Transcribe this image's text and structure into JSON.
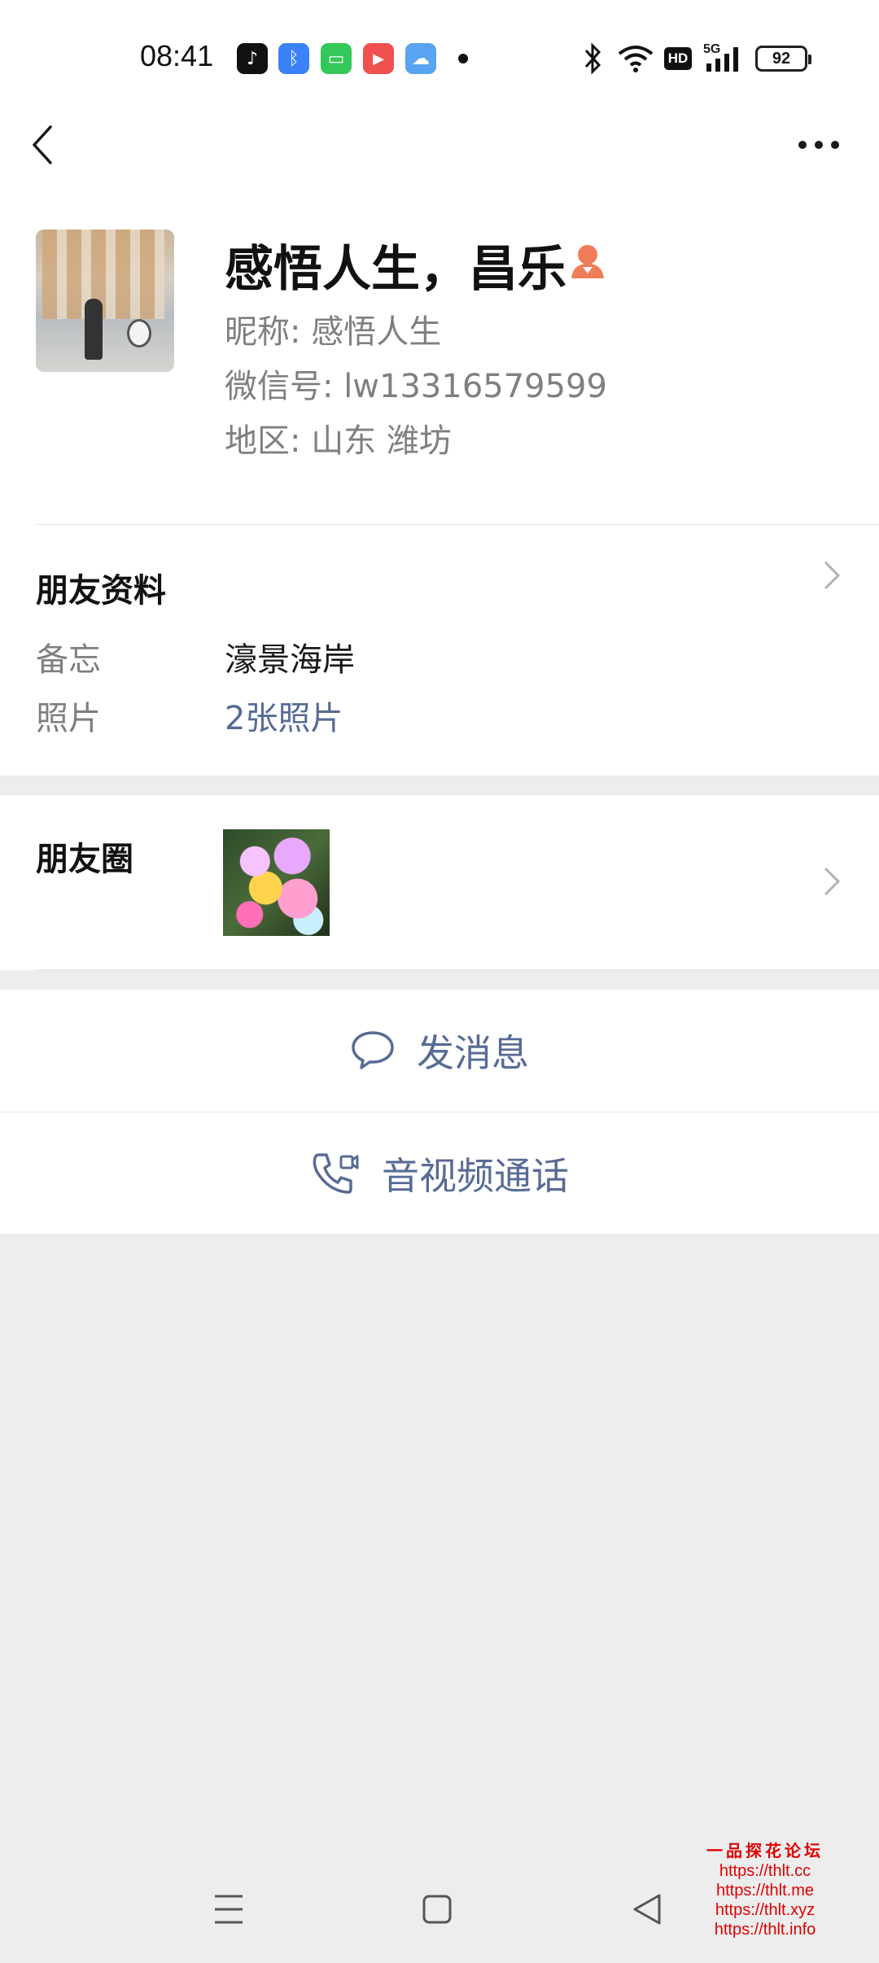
{
  "status_bar": {
    "time": "08:41",
    "apps": [
      {
        "name": "tiktok-icon",
        "glyph": "♪",
        "color": "#111111"
      },
      {
        "name": "bluetooth-app-icon",
        "glyph": "ᛒ",
        "color": "#3b82f6"
      },
      {
        "name": "messages-icon",
        "glyph": "▭",
        "color": "#34c759"
      },
      {
        "name": "video-icon",
        "glyph": "▶",
        "color": "#f0504e"
      },
      {
        "name": "weather-icon",
        "glyph": "☁",
        "color": "#5aa3f0"
      }
    ],
    "hd_label": "HD",
    "network_label": "5G",
    "battery": "92"
  },
  "profile": {
    "display_name": "感悟人生，昌乐",
    "nickname": "昵称:  感悟人生",
    "wechat_id": "微信号:  lw13316579599",
    "region": "地区:  山东  潍坊"
  },
  "friend_info": {
    "title": "朋友资料",
    "rows": [
      {
        "label": "备忘",
        "value": "濠景海岸"
      },
      {
        "label": "照片",
        "value": "2张照片"
      }
    ]
  },
  "moments": {
    "title": "朋友圈"
  },
  "actions": {
    "message": "发消息",
    "call": "音视频通话"
  },
  "watermark": {
    "title": "一品探花论坛",
    "links": [
      "https://thlt.cc",
      "https://thlt.me",
      "https://thlt.xyz",
      "https://thlt.info"
    ]
  },
  "colors": {
    "link": "#576b95",
    "gender_icon": "#f07c5a",
    "background": "#ededed",
    "watermark": "#e00000"
  }
}
